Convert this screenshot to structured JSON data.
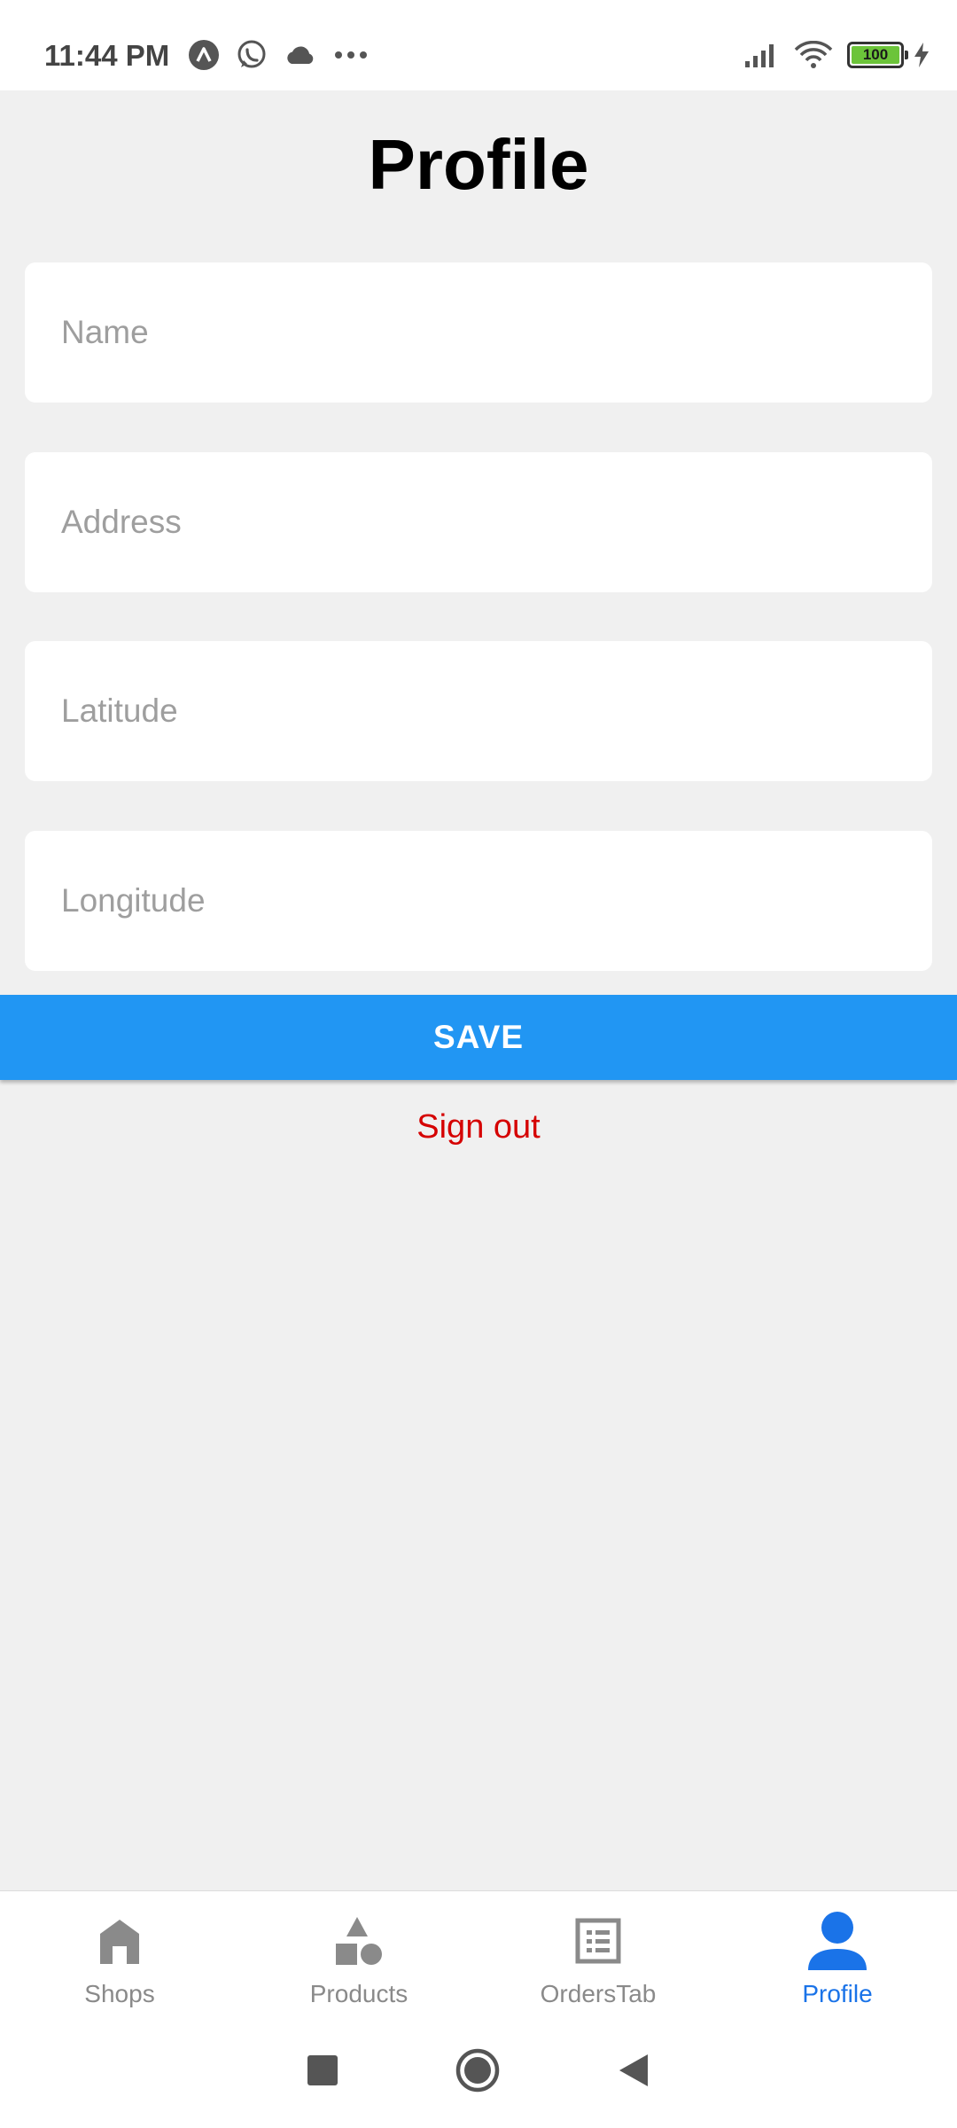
{
  "status_bar": {
    "time": "11:44 PM",
    "battery_level": "100",
    "left_icons": [
      "app-icon",
      "whatsapp-icon",
      "cloud-icon",
      "more-dots-icon"
    ],
    "right_icons": [
      "signal-icon",
      "wifi-icon",
      "battery-icon",
      "charging-icon"
    ]
  },
  "header": {
    "title": "Profile"
  },
  "form": {
    "name": {
      "placeholder": "Name",
      "value": ""
    },
    "address": {
      "placeholder": "Address",
      "value": ""
    },
    "latitude": {
      "placeholder": "Latitude",
      "value": ""
    },
    "longitude": {
      "placeholder": "Longitude",
      "value": ""
    }
  },
  "actions": {
    "save_label": "SAVE",
    "sign_out_label": "Sign out"
  },
  "tabs": [
    {
      "label": "Shops",
      "icon": "home-icon",
      "active": false
    },
    {
      "label": "Products",
      "icon": "shapes-icon",
      "active": false
    },
    {
      "label": "OrdersTab",
      "icon": "list-icon",
      "active": false
    },
    {
      "label": "Profile",
      "icon": "person-icon",
      "active": true
    }
  ],
  "colors": {
    "accent": "#2196f3",
    "active_tab": "#1a73e8",
    "inactive_tab": "#8a8a8a",
    "sign_out": "#d50000",
    "background": "#f0f0f0"
  },
  "nav_bar": {
    "buttons": [
      "recents-square-icon",
      "home-circle-icon",
      "back-triangle-icon"
    ]
  }
}
